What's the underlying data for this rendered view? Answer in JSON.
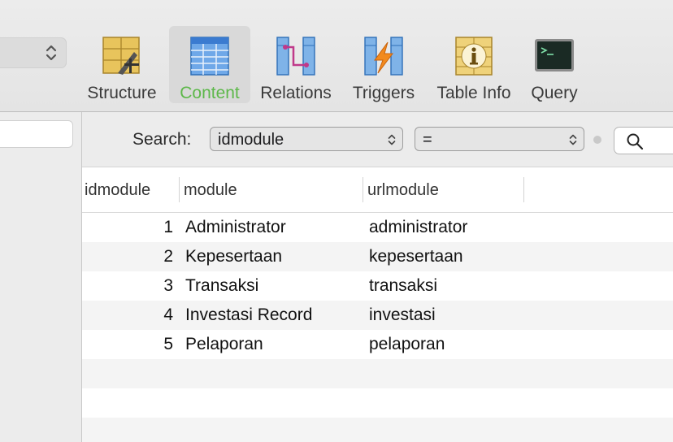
{
  "toolbar": {
    "items": [
      {
        "label": "Structure",
        "icon": "structure-icon"
      },
      {
        "label": "Content",
        "icon": "content-icon",
        "active": true
      },
      {
        "label": "Relations",
        "icon": "relations-icon"
      },
      {
        "label": "Triggers",
        "icon": "triggers-icon"
      },
      {
        "label": "Table Info",
        "icon": "table-info-icon"
      },
      {
        "label": "Query",
        "icon": "query-icon"
      }
    ],
    "active_color": "#5db84a"
  },
  "filter": {
    "label": "Search:",
    "field": "idmodule",
    "operator": "="
  },
  "table": {
    "columns": [
      "idmodule",
      "module",
      "urlmodule"
    ],
    "rows": [
      [
        "1",
        "Administrator",
        "administrator"
      ],
      [
        "2",
        "Kepesertaan",
        "kepesertaan"
      ],
      [
        "3",
        "Transaksi",
        "transaksi"
      ],
      [
        "4",
        "Investasi Record",
        "investasi"
      ],
      [
        "5",
        "Pelaporan",
        "pelaporan"
      ]
    ]
  }
}
